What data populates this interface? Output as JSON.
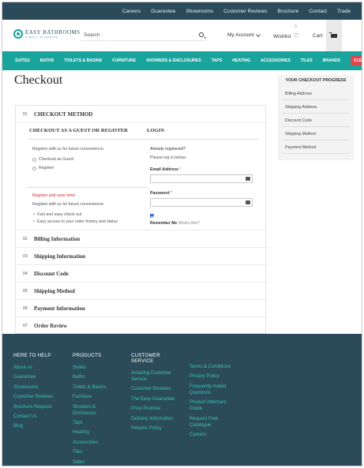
{
  "topbar": {
    "links": [
      "Careers",
      "Guarantee",
      "Showrooms",
      "Customer Reviews",
      "Brochure",
      "Contact",
      "Trade"
    ]
  },
  "header": {
    "logo_name": "EASY BATHROOMS",
    "logo_tagline": "SIMPLY STUNNING",
    "search_placeholder": "Search",
    "account_label": "My Account",
    "wishlist_label": "Wishlist",
    "wishlist_count": "0",
    "cart_label": "Cart"
  },
  "nav": {
    "items": [
      "SUITES",
      "BATHS",
      "TOILETS & BASINS",
      "FURNITURE",
      "SHOWERS & ENCLOSURES",
      "TAPS",
      "HEATING",
      "ACCESSORIES",
      "TILES",
      "BRANDS"
    ],
    "clearance": "CLEARANCE"
  },
  "page_title": "Checkout",
  "steps": [
    {
      "num": "01",
      "name": "Checkout Method"
    },
    {
      "num": "02",
      "name": "Billing Information"
    },
    {
      "num": "03",
      "name": "Shipping Information"
    },
    {
      "num": "04",
      "name": "Discount Code"
    },
    {
      "num": "05",
      "name": "Shipping Method"
    },
    {
      "num": "06",
      "name": "Payment Information"
    },
    {
      "num": "07",
      "name": "Order Review"
    }
  ],
  "guest": {
    "heading": "CHECKOUT AS A GUEST OR REGISTER",
    "intro": "Register with us for future convenience:",
    "option_guest": "Checkout as Guest",
    "option_register": "Register",
    "save_time": "Register and save time!",
    "save_intro": "Register with us for future convenience:",
    "benefits": [
      "Fast and easy check out",
      "Easy access to your order history and status"
    ]
  },
  "login": {
    "heading": "LOGIN",
    "already": "Already registered?",
    "please": "Please log in below:",
    "email_label": "Email Address",
    "password_label": "Password",
    "required_mark": "*",
    "remember": "Remember Me",
    "whats_this": "What's this?"
  },
  "progress": {
    "heading": "YOUR CHECKOUT PROGRESS",
    "items": [
      "Billing Address",
      "Shipping Address",
      "Discount Code",
      "Shipping Method",
      "Payment Method"
    ]
  },
  "footer": {
    "col1": {
      "heading": "HERE TO HELP",
      "links": [
        "About us",
        "Guarantee",
        "Showrooms",
        "Customer Reviews",
        "Brochure Request",
        "Contact Us",
        "Blog"
      ]
    },
    "col2": {
      "heading": "PRODUCTS",
      "links": [
        "Suites",
        "Baths",
        "Toilets & Basins",
        "Furniture",
        "Showers & Enclosures",
        "Taps",
        "Heating",
        "Accessories",
        "Tiles",
        "Sales"
      ]
    },
    "col3": {
      "heading": "CUSTOMER SERVICE",
      "links": [
        "Amazing Customer Service",
        "Customer Reviews",
        "The Easy Guarantee",
        "Price Promise",
        "Delivery Information",
        "Returns Policy"
      ]
    },
    "col4": {
      "links": [
        "Terms & Conditions",
        "Privacy Policy",
        "Frequently Asked Questions",
        "Product Aftercare Guide",
        "Request Free Catalogue",
        "Careers"
      ]
    }
  },
  "colors": {
    "teal": "#19a59d",
    "navy": "#2b4b5a",
    "clearance": "#e0474c",
    "link": "#39c1b6",
    "required": "#d12f2f"
  }
}
